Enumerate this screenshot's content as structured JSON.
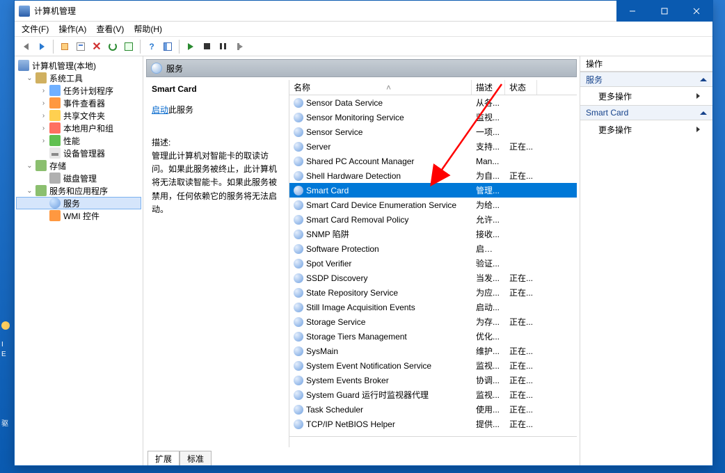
{
  "window": {
    "title": "计算机管理"
  },
  "menubar": [
    "文件(F)",
    "操作(A)",
    "查看(V)",
    "帮助(H)"
  ],
  "tree": {
    "root": "计算机管理(本地)",
    "g1": {
      "label": "系统工具",
      "items": [
        "任务计划程序",
        "事件查看器",
        "共享文件夹",
        "本地用户和组",
        "性能",
        "设备管理器"
      ]
    },
    "g2": {
      "label": "存储",
      "items": [
        "磁盘管理"
      ]
    },
    "g3": {
      "label": "服务和应用程序",
      "items": [
        "服务",
        "WMI 控件"
      ]
    }
  },
  "center": {
    "header": "服务",
    "detail": {
      "title": "Smart Card",
      "start_link_a": "启动",
      "start_link_b": "此服务",
      "desc_label": "描述:",
      "desc_text": "管理此计算机对智能卡的取读访问。如果此服务被终止，此计算机将无法取读智能卡。如果此服务被禁用，任何依赖它的服务将无法启动。"
    },
    "cols": {
      "name": "名称",
      "desc": "描述",
      "stat": "状态"
    },
    "rows": [
      {
        "name": "Sensor Data Service",
        "desc": "从各...",
        "stat": ""
      },
      {
        "name": "Sensor Monitoring Service",
        "desc": "监视...",
        "stat": ""
      },
      {
        "name": "Sensor Service",
        "desc": "一项...",
        "stat": ""
      },
      {
        "name": "Server",
        "desc": "支持...",
        "stat": "正在..."
      },
      {
        "name": "Shared PC Account Manager",
        "desc": "Man...",
        "stat": ""
      },
      {
        "name": "Shell Hardware Detection",
        "desc": "为自...",
        "stat": "正在..."
      },
      {
        "name": "Smart Card",
        "desc": "管理...",
        "stat": "",
        "sel": true
      },
      {
        "name": "Smart Card Device Enumeration Service",
        "desc": "为给...",
        "stat": ""
      },
      {
        "name": "Smart Card Removal Policy",
        "desc": "允许...",
        "stat": ""
      },
      {
        "name": "SNMP 陷阱",
        "desc": "接收...",
        "stat": ""
      },
      {
        "name": "Software Protection",
        "desc": "启用 ...",
        "stat": ""
      },
      {
        "name": "Spot Verifier",
        "desc": "验证...",
        "stat": ""
      },
      {
        "name": "SSDP Discovery",
        "desc": "当发...",
        "stat": "正在..."
      },
      {
        "name": "State Repository Service",
        "desc": "为应...",
        "stat": "正在..."
      },
      {
        "name": "Still Image Acquisition Events",
        "desc": "启动...",
        "stat": ""
      },
      {
        "name": "Storage Service",
        "desc": "为存...",
        "stat": "正在..."
      },
      {
        "name": "Storage Tiers Management",
        "desc": "优化...",
        "stat": ""
      },
      {
        "name": "SysMain",
        "desc": "维护...",
        "stat": "正在..."
      },
      {
        "name": "System Event Notification Service",
        "desc": "监视...",
        "stat": "正在..."
      },
      {
        "name": "System Events Broker",
        "desc": "协调...",
        "stat": "正在..."
      },
      {
        "name": "System Guard 运行时监视器代理",
        "desc": "监视...",
        "stat": "正在..."
      },
      {
        "name": "Task Scheduler",
        "desc": "使用...",
        "stat": "正在..."
      },
      {
        "name": "TCP/IP NetBIOS Helper",
        "desc": "提供...",
        "stat": "正在..."
      }
    ],
    "tabs": [
      "扩展",
      "标准"
    ]
  },
  "actions": {
    "title": "操作",
    "g1": {
      "header": "服务",
      "item": "更多操作"
    },
    "g2": {
      "header": "Smart Card",
      "item": "更多操作"
    }
  },
  "desktop": {
    "i": "I",
    "e": "E",
    "drv": "驱"
  }
}
